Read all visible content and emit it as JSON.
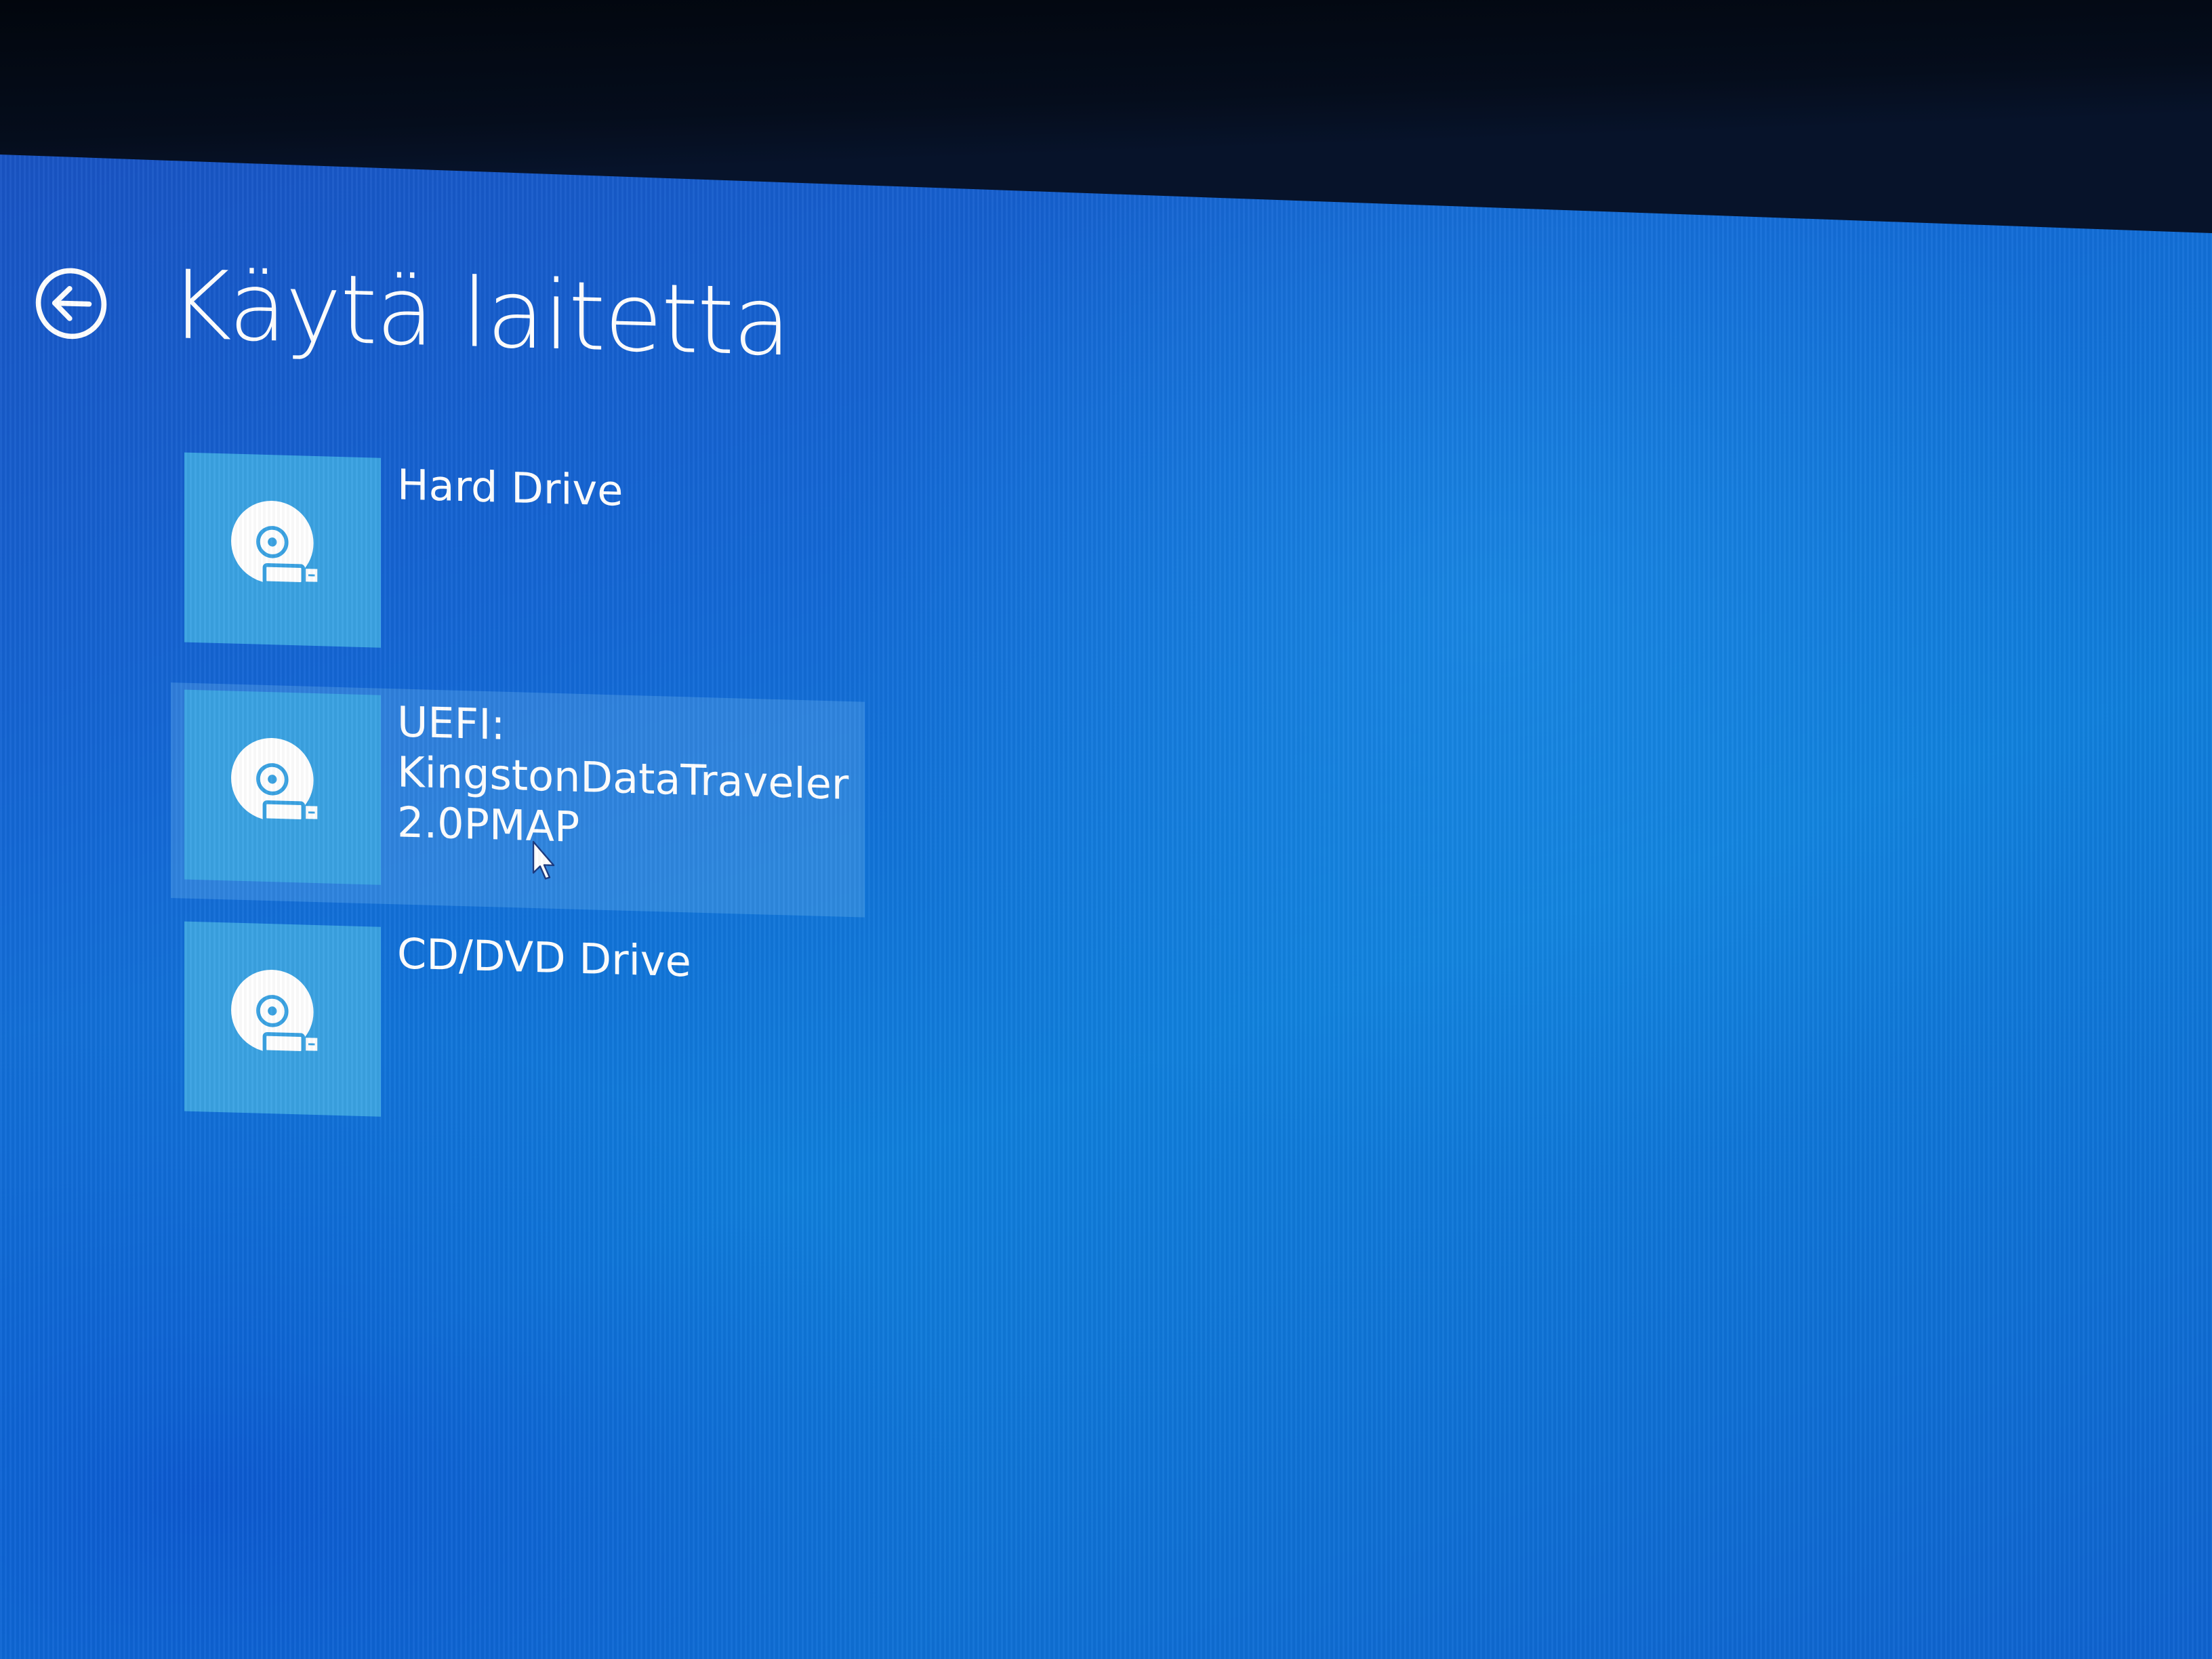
{
  "page": {
    "title": "Käytä laitetta",
    "back_icon": "arrow-left-circle-icon",
    "colors": {
      "background": "#1368d6",
      "tile": "#3aa2e2",
      "text": "#ffffff"
    }
  },
  "devices": [
    {
      "icon": "drive-disc-icon",
      "lines": [
        "Hard Drive"
      ],
      "selected": false
    },
    {
      "icon": "drive-disc-icon",
      "lines": [
        "UEFI:",
        "KingstonDataTraveler",
        "2.0PMAP"
      ],
      "selected": true
    },
    {
      "icon": "drive-disc-icon",
      "lines": [
        "CD/DVD Drive"
      ],
      "selected": false
    }
  ]
}
